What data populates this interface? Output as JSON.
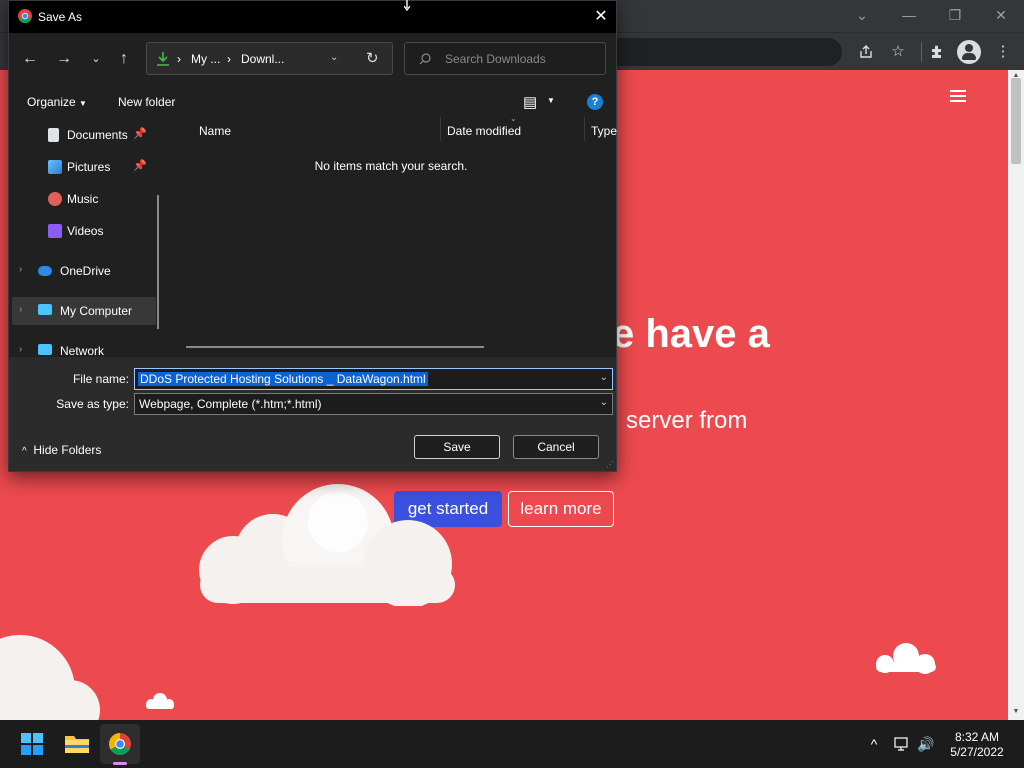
{
  "browser": {
    "window_controls": {
      "minimize": "—",
      "restore": "❐",
      "close": "✕",
      "tab_search": "⌄"
    },
    "toolbar_icons": [
      "share-icon",
      "star-icon",
      "extensions-icon",
      "profile-avatar",
      "kebab-menu-icon"
    ]
  },
  "webpage": {
    "hero_title": "e have a",
    "hero_subtitle": "server from",
    "cta_primary": "get started",
    "cta_secondary": "learn more",
    "colors": {
      "background": "#ec4a4e",
      "primary_button": "#3b50dc"
    }
  },
  "dialog": {
    "title": "Save As",
    "address": {
      "crumb1": "My ...",
      "crumb2": "Downl...",
      "sep": "›"
    },
    "search_placeholder": "Search Downloads",
    "organize_label": "Organize",
    "new_folder_label": "New folder",
    "help_label": "?",
    "nav_items": [
      {
        "label": "Documents",
        "pinned": true
      },
      {
        "label": "Pictures",
        "pinned": true
      },
      {
        "label": "Music",
        "pinned": false
      },
      {
        "label": "Videos",
        "pinned": false
      },
      {
        "label": "OneDrive",
        "expandable": true
      },
      {
        "label": "My Computer",
        "expandable": true,
        "selected": true
      },
      {
        "label": "Network",
        "expandable": true
      }
    ],
    "columns": [
      "Name",
      "Date modified",
      "Type"
    ],
    "empty_message": "No items match your search.",
    "file_name_label": "File name:",
    "file_name_value": "DDoS Protected Hosting Solutions _ DataWagon.html",
    "save_type_label": "Save as type:",
    "save_type_value": "Webpage, Complete (*.htm;*.html)",
    "hide_folders_label": "Hide Folders",
    "save_label": "Save",
    "cancel_label": "Cancel"
  },
  "taskbar": {
    "time": "8:32 AM",
    "date": "5/27/2022"
  }
}
